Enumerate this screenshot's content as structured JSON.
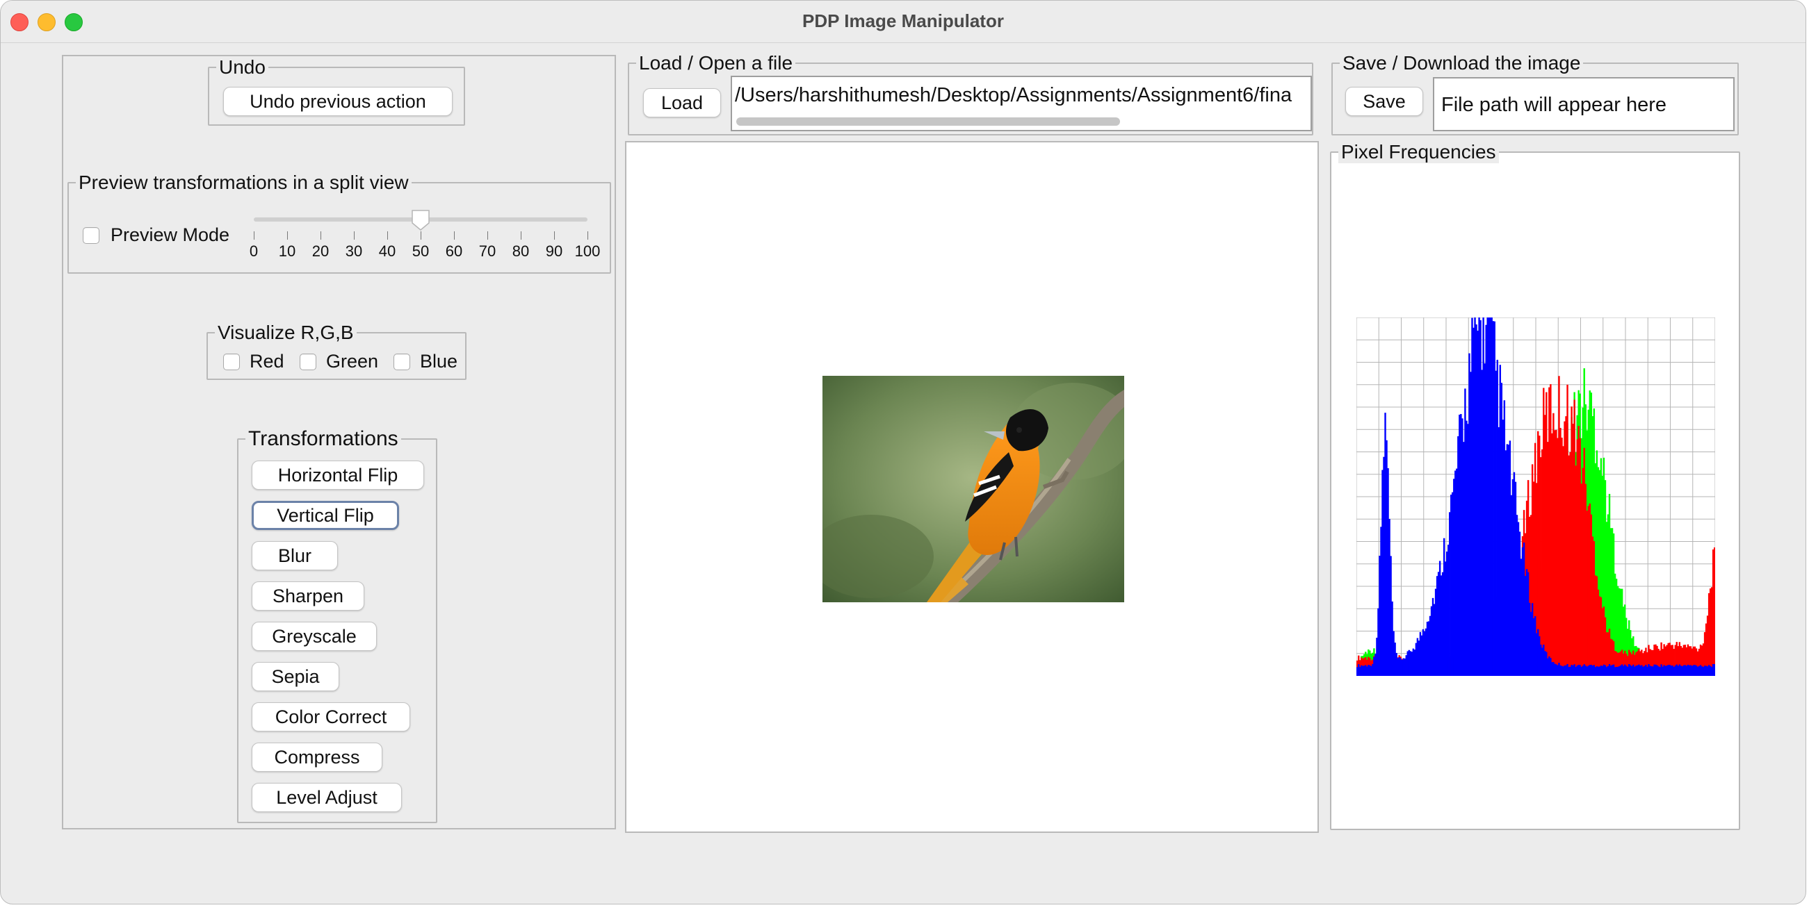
{
  "window": {
    "title": "PDP Image Manipulator"
  },
  "undo": {
    "legend": "Undo",
    "button": "Undo previous action"
  },
  "preview": {
    "legend": "Preview transformations in a split view",
    "checkbox_label": "Preview Mode",
    "checked": false,
    "slider_value": 50,
    "slider_min": 0,
    "slider_max": 100,
    "ticks": [
      "0",
      "10",
      "20",
      "30",
      "40",
      "50",
      "60",
      "70",
      "80",
      "90",
      "100"
    ]
  },
  "rgb": {
    "legend": "Visualize R,G,B",
    "red_label": "Red",
    "green_label": "Green",
    "blue_label": "Blue"
  },
  "transformations": {
    "legend": "Transformations",
    "buttons": [
      "Horizontal Flip",
      "Vertical Flip",
      "Blur",
      "Sharpen",
      "Greyscale",
      "Sepia",
      "Color Correct",
      "Compress",
      "Level Adjust"
    ],
    "focused": "Vertical Flip"
  },
  "load": {
    "legend": "Load / Open a file",
    "button": "Load",
    "path": "/Users/harshithumesh/Desktop/Assignments/Assignment6/fina"
  },
  "save": {
    "legend": "Save / Download the image",
    "button": "Save",
    "path": "File path will appear here"
  },
  "histogram": {
    "legend": "Pixel Frequencies",
    "colors": {
      "red": "#ff0000",
      "green": "#00ff00",
      "blue": "#0000ff",
      "grid": "#b5b5b5"
    }
  },
  "icons": {
    "close": "close-window-icon",
    "minimize": "minimize-window-icon",
    "maximize": "maximize-window-icon",
    "bird_image": "bird-photo"
  }
}
